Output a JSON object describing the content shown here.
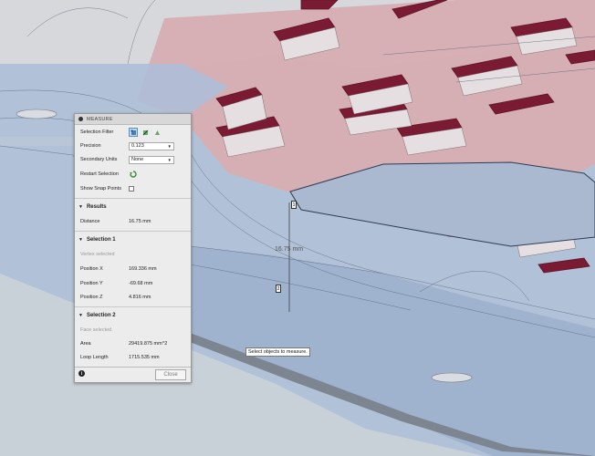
{
  "panel": {
    "title": "MEASURE",
    "selection_filter_label": "Selection Filter",
    "precision_label": "Precision",
    "precision_value": "0.123",
    "secondary_units_label": "Secondary Units",
    "secondary_units_value": "None",
    "restart_selection_label": "Restart Selection",
    "show_snap_points_label": "Show Snap Points",
    "results": {
      "title": "Results",
      "distance_label": "Distance",
      "distance_value": "16.75 mm"
    },
    "selection1": {
      "title": "Selection 1",
      "status": "Vertex selected",
      "pos_x_label": "Position X",
      "pos_x_value": "169.336 mm",
      "pos_y_label": "Position Y",
      "pos_y_value": "-69.68 mm",
      "pos_z_label": "Position Z",
      "pos_z_value": "4.816 mm"
    },
    "selection2": {
      "title": "Selection 2",
      "status": "Face selected",
      "area_label": "Area",
      "area_value": "29419.875 mm^2",
      "loop_length_label": "Loop Length",
      "loop_length_value": "1715.535 mm"
    },
    "close_label": "Close"
  },
  "viewport": {
    "dimension_label": "16.75 mm",
    "marker1": "1",
    "marker2": "2",
    "tooltip": "Select objects to measure."
  },
  "colors": {
    "body_blue": "#aebfd8",
    "red_face": "#c9868f",
    "pocket_dark": "#7a1a33",
    "background": "#c7cfd6"
  }
}
